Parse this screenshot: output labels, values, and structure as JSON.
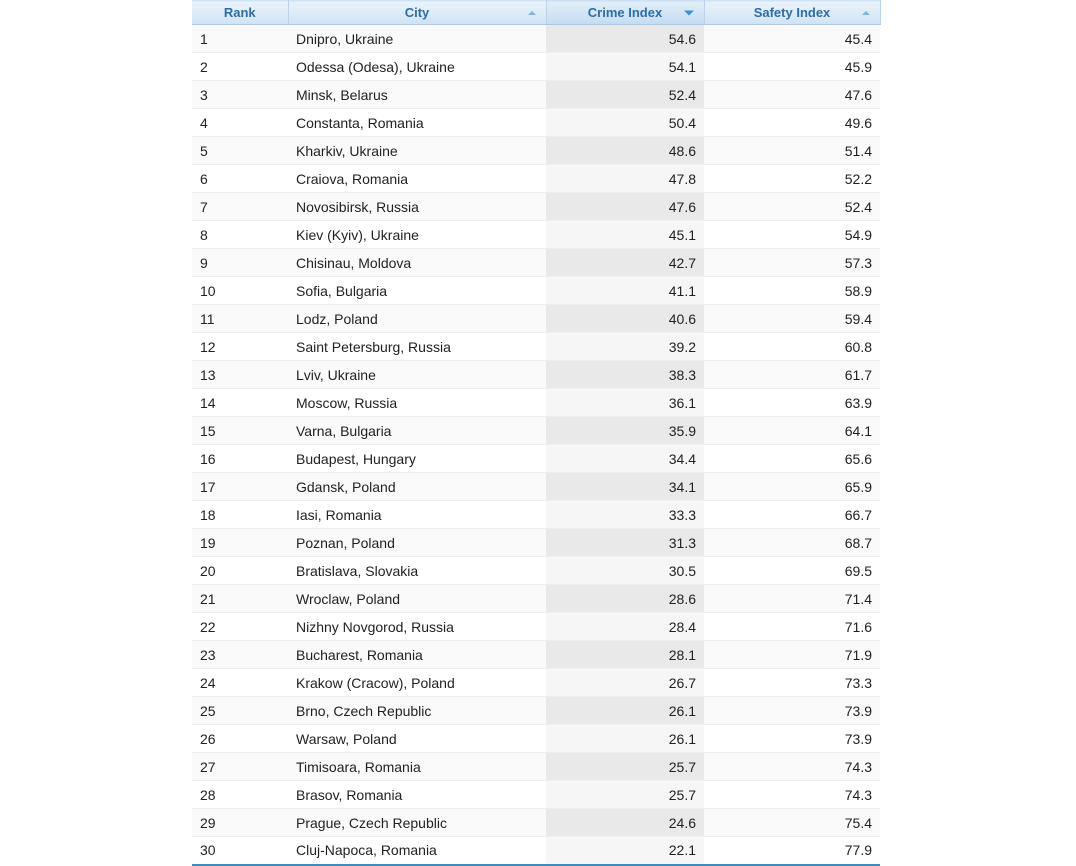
{
  "table": {
    "columns": [
      {
        "key": "rank",
        "label": "Rank",
        "sort_icon": "none",
        "align": "left",
        "sorted": false
      },
      {
        "key": "city",
        "label": "City",
        "sort_icon": "caret-up-icon",
        "align": "center",
        "sorted": false
      },
      {
        "key": "crime",
        "label": "Crime Index",
        "sort_icon": "caret-down-icon",
        "align": "center",
        "sorted": true
      },
      {
        "key": "safety",
        "label": "Safety Index",
        "sort_icon": "caret-up-icon",
        "align": "center",
        "sorted": false
      }
    ],
    "rows": [
      {
        "rank": "1",
        "city": "Dnipro, Ukraine",
        "crime": "54.6",
        "safety": "45.4"
      },
      {
        "rank": "2",
        "city": "Odessa (Odesa), Ukraine",
        "crime": "54.1",
        "safety": "45.9"
      },
      {
        "rank": "3",
        "city": "Minsk, Belarus",
        "crime": "52.4",
        "safety": "47.6"
      },
      {
        "rank": "4",
        "city": "Constanta, Romania",
        "crime": "50.4",
        "safety": "49.6"
      },
      {
        "rank": "5",
        "city": "Kharkiv, Ukraine",
        "crime": "48.6",
        "safety": "51.4"
      },
      {
        "rank": "6",
        "city": "Craiova, Romania",
        "crime": "47.8",
        "safety": "52.2"
      },
      {
        "rank": "7",
        "city": "Novosibirsk, Russia",
        "crime": "47.6",
        "safety": "52.4"
      },
      {
        "rank": "8",
        "city": "Kiev (Kyiv), Ukraine",
        "crime": "45.1",
        "safety": "54.9"
      },
      {
        "rank": "9",
        "city": "Chisinau, Moldova",
        "crime": "42.7",
        "safety": "57.3"
      },
      {
        "rank": "10",
        "city": "Sofia, Bulgaria",
        "crime": "41.1",
        "safety": "58.9"
      },
      {
        "rank": "11",
        "city": "Lodz, Poland",
        "crime": "40.6",
        "safety": "59.4"
      },
      {
        "rank": "12",
        "city": "Saint Petersburg, Russia",
        "crime": "39.2",
        "safety": "60.8"
      },
      {
        "rank": "13",
        "city": "Lviv, Ukraine",
        "crime": "38.3",
        "safety": "61.7"
      },
      {
        "rank": "14",
        "city": "Moscow, Russia",
        "crime": "36.1",
        "safety": "63.9"
      },
      {
        "rank": "15",
        "city": "Varna, Bulgaria",
        "crime": "35.9",
        "safety": "64.1"
      },
      {
        "rank": "16",
        "city": "Budapest, Hungary",
        "crime": "34.4",
        "safety": "65.6"
      },
      {
        "rank": "17",
        "city": "Gdansk, Poland",
        "crime": "34.1",
        "safety": "65.9"
      },
      {
        "rank": "18",
        "city": "Iasi, Romania",
        "crime": "33.3",
        "safety": "66.7"
      },
      {
        "rank": "19",
        "city": "Poznan, Poland",
        "crime": "31.3",
        "safety": "68.7"
      },
      {
        "rank": "20",
        "city": "Bratislava, Slovakia",
        "crime": "30.5",
        "safety": "69.5"
      },
      {
        "rank": "21",
        "city": "Wroclaw, Poland",
        "crime": "28.6",
        "safety": "71.4"
      },
      {
        "rank": "22",
        "city": "Nizhny Novgorod, Russia",
        "crime": "28.4",
        "safety": "71.6"
      },
      {
        "rank": "23",
        "city": "Bucharest, Romania",
        "crime": "28.1",
        "safety": "71.9"
      },
      {
        "rank": "24",
        "city": "Krakow (Cracow), Poland",
        "crime": "26.7",
        "safety": "73.3"
      },
      {
        "rank": "25",
        "city": "Brno, Czech Republic",
        "crime": "26.1",
        "safety": "73.9"
      },
      {
        "rank": "26",
        "city": "Warsaw, Poland",
        "crime": "26.1",
        "safety": "73.9"
      },
      {
        "rank": "27",
        "city": "Timisoara, Romania",
        "crime": "25.7",
        "safety": "74.3"
      },
      {
        "rank": "28",
        "city": "Brasov, Romania",
        "crime": "25.7",
        "safety": "74.3"
      },
      {
        "rank": "29",
        "city": "Prague, Czech Republic",
        "crime": "24.6",
        "safety": "75.4"
      },
      {
        "rank": "30",
        "city": "Cluj-Napoca, Romania",
        "crime": "22.1",
        "safety": "77.9"
      }
    ]
  },
  "colors": {
    "header_text": "#2e6da4",
    "header_bg": "#dcebf8",
    "bottom_border": "#3c8dbc",
    "row_alt_bg": "#fafafa",
    "sorted_col_bg": "#e9e9e9",
    "body_text": "#222222"
  }
}
